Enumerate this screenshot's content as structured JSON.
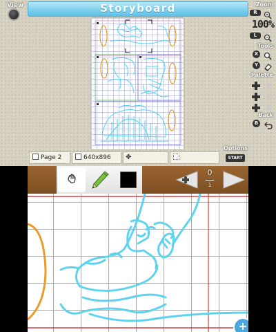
{
  "top": {
    "title": "Storyboard",
    "view_label": "View",
    "zoom": {
      "label": "Zoom",
      "r_button": "R",
      "level": "100%",
      "l_button": "L"
    },
    "tools": {
      "label": "Tools",
      "x_button": "X",
      "y_button": "Y"
    },
    "palette": {
      "label": "Palette"
    },
    "back": {
      "label": "Back",
      "b_button": "B"
    },
    "status": {
      "page": "Page 2",
      "size": "640x896",
      "field3": "",
      "field4": ""
    },
    "options": {
      "label": "Options",
      "start_button": "START"
    }
  },
  "bottom": {
    "frame": {
      "current": "0",
      "total": "1"
    },
    "current_color": "#000000",
    "zoom_fab": "+"
  },
  "colors": {
    "title_bar": "#7fd0ee",
    "stroke_cyan": "#5fd3ee",
    "stroke_orange": "#e89a2a",
    "toolbar_wood": "#8b5a2b"
  }
}
